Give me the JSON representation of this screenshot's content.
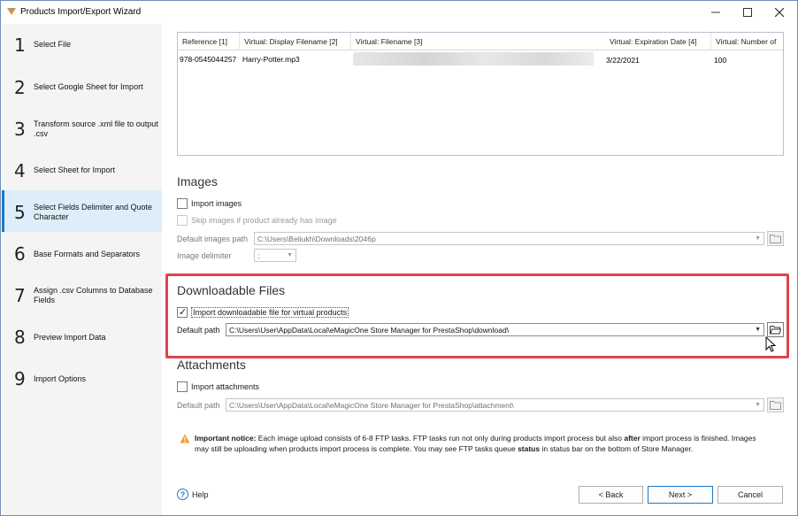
{
  "window": {
    "title": "Products Import/Export Wizard"
  },
  "steps": [
    {
      "num": "1",
      "label": "Select File"
    },
    {
      "num": "2",
      "label": "Select Google Sheet for Import"
    },
    {
      "num": "3",
      "label": "Transform source .xml file to output .csv"
    },
    {
      "num": "4",
      "label": "Select Sheet for Import"
    },
    {
      "num": "5",
      "label": "Select Fields Delimiter and Quote Character",
      "active": true
    },
    {
      "num": "6",
      "label": "Base Formats and Separators"
    },
    {
      "num": "7",
      "label": "Assign .csv Columns to Database Fields"
    },
    {
      "num": "8",
      "label": "Preview Import Data"
    },
    {
      "num": "9",
      "label": "Import Options"
    }
  ],
  "grid": {
    "headers": [
      "Reference [1]",
      "Virtual: Display Filename [2]",
      "Virtual: Filename [3]",
      "Virtual: Expiration Date [4]",
      "Virtual: Number of"
    ],
    "row": [
      "978-0545044257",
      "Harry-Potter.mp3",
      "",
      "3/22/2021",
      "100"
    ]
  },
  "images": {
    "title": "Images",
    "import_label": "Import images",
    "skip_label": "Skip images if product already has image",
    "path_label": "Default images path",
    "path_value": "C:\\Users\\Beliukh\\Downloads\\2046p",
    "delimiter_label": "Image delimiter",
    "delimiter_value": ";"
  },
  "downloadable": {
    "title": "Downloadable Files",
    "import_label": "Import downloadable file for virtual products",
    "path_label": "Default path",
    "path_value": "C:\\Users\\User\\AppData\\Local\\eMagicOne Store Manager for PrestaShop\\download\\"
  },
  "attachments": {
    "title": "Attachments",
    "import_label": "Import attachments",
    "path_label": "Default path",
    "path_value": "C:\\Users\\User\\AppData\\Local\\eMagicOne Store Manager for PrestaShop\\attachment\\"
  },
  "notice": {
    "bold_prefix": "Important notice:",
    "text1": " Each image upload consists of 6-8 FTP tasks. FTP tasks run not only during products import process but also ",
    "bold_after": "after",
    "text2": " import process is finished. Images may still be uploading when products import process is complete. You may see FTP tasks queue ",
    "bold_status": "status",
    "text3": " in status bar on the bottom of Store Manager."
  },
  "footer": {
    "help_label": "Help",
    "back_label": "< Back",
    "next_label": "Next >",
    "cancel_label": "Cancel"
  },
  "colors": {
    "accent": "#1e78c8",
    "highlight": "#e0424d",
    "active_step_bg": "#ddeefa"
  }
}
